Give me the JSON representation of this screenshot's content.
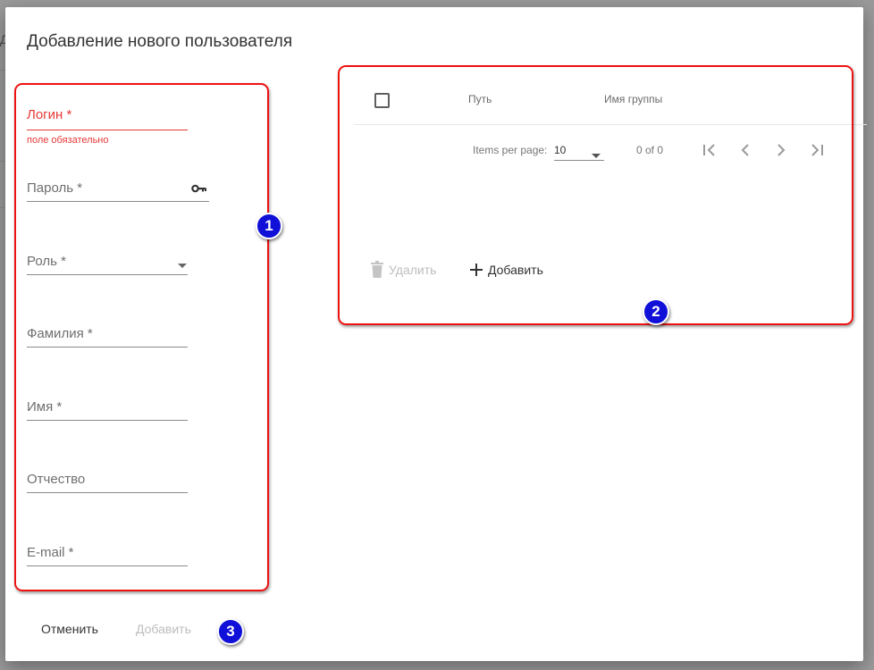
{
  "background": {
    "partial_char": "Д"
  },
  "dialog": {
    "title": "Добавление нового пользователя",
    "form": {
      "login": {
        "label": "Логин *",
        "error": "поле обязательно"
      },
      "password": {
        "label": "Пароль *",
        "icon": "key-icon"
      },
      "role": {
        "label": "Роль *",
        "icon": "dropdown-arrow-icon"
      },
      "lastname": {
        "label": "Фамилия *"
      },
      "firstname": {
        "label": "Имя *"
      },
      "middlename": {
        "label": "Отчество"
      },
      "email": {
        "label": "E-mail *"
      }
    },
    "groups_table": {
      "columns": [
        "Путь",
        "Имя группы"
      ],
      "rows": [],
      "paginator": {
        "items_per_page_label": "Items per page:",
        "items_per_page_value": "10",
        "range_label": "0 of 0"
      },
      "delete_label": "Удалить",
      "add_label": "Добавить"
    },
    "actions": {
      "cancel_label": "Отменить",
      "submit_label": "Добавить"
    }
  },
  "annotations": [
    "1",
    "2",
    "3"
  ],
  "colors": {
    "error": "#e53935",
    "annotation_border": "#e11111",
    "badge": "#1010d8",
    "disabled_text": "#bdbdbd"
  }
}
